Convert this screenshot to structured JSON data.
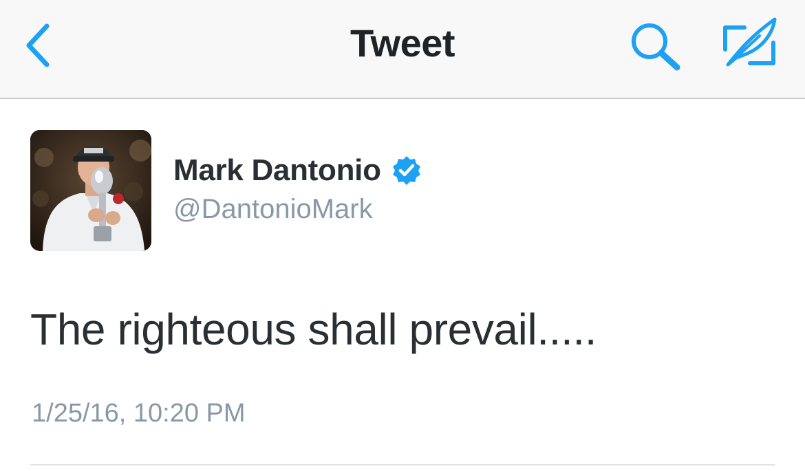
{
  "nav": {
    "title": "Tweet",
    "back_icon": "chevron-left-icon",
    "search_icon": "search-icon",
    "compose_icon": "compose-tweet-icon"
  },
  "tweet": {
    "author": {
      "name": "Mark Dantonio",
      "handle": "@DantonioMark",
      "verified": true,
      "avatar": "profile-photo"
    },
    "text": "The righteous shall prevail.....",
    "timestamp": "1/25/16, 10:20 PM"
  },
  "colors": {
    "accent": "#1da1f2",
    "text_primary": "#292f33",
    "text_secondary": "#8899a6",
    "nav_background": "#f8f8f9"
  }
}
